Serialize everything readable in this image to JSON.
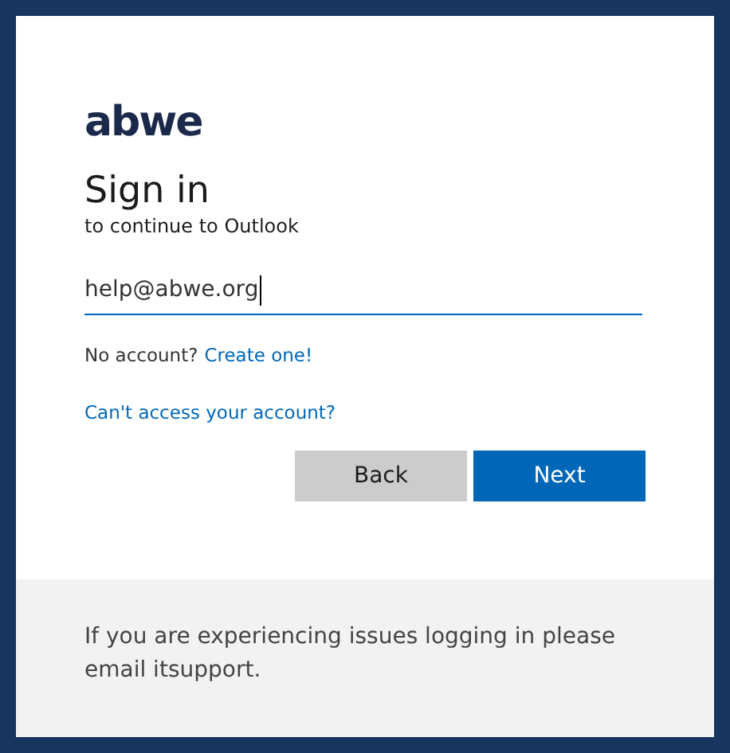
{
  "logo": {
    "text": "abwe"
  },
  "title": "Sign in",
  "subtitle": "to continue to Outlook",
  "email_field": {
    "value": "help@abwe.org",
    "focused": true
  },
  "no_account": {
    "text": "No account?",
    "link": "Create one!"
  },
  "cant_access_link": "Can't access your account?",
  "buttons": [
    {
      "label": "Back",
      "kind": "secondary"
    },
    {
      "label": "Next",
      "kind": "primary"
    }
  ],
  "footer": {
    "text": "If you are experiencing issues logging in please email itsupport."
  }
}
